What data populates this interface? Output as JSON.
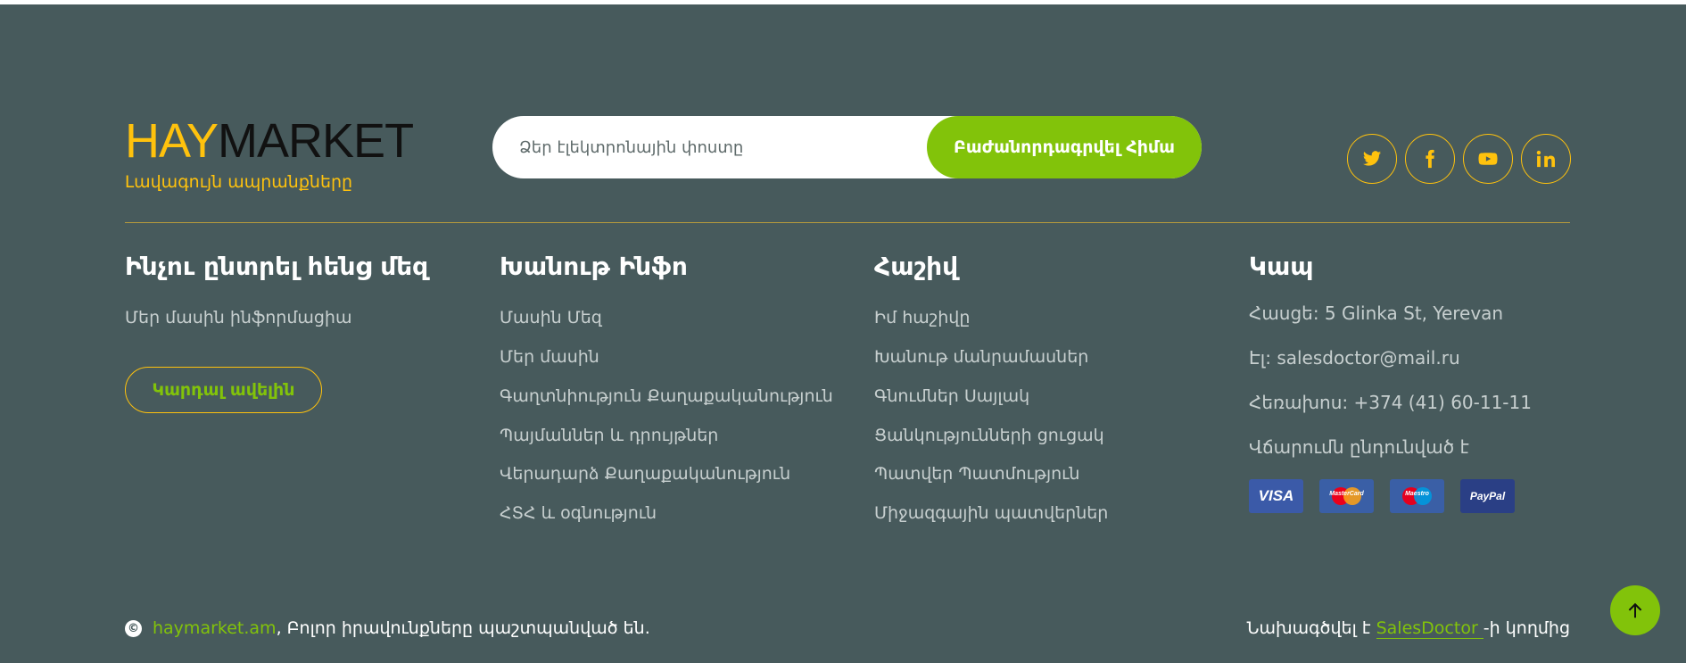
{
  "brand": {
    "logo_part1": "HAY",
    "logo_part2": "MARKET",
    "tagline": "Լավագույն ապրանքները"
  },
  "subscribe": {
    "placeholder": "Ձեր էլեկտրոնային փոստը",
    "button_label": "Բաժանորդագրվել Հիմա"
  },
  "socials": [
    {
      "icon": "twitter-icon"
    },
    {
      "icon": "facebook-icon"
    },
    {
      "icon": "youtube-icon"
    },
    {
      "icon": "linkedin-icon"
    }
  ],
  "columns": {
    "why": {
      "title": "Ինչու ընտրել հենց մեզ",
      "text": "Մեր մասին ինֆորմացիա",
      "button_label": "Կարդալ ավելին"
    },
    "shop_info": {
      "title": "Խանութ Ինֆո",
      "links": [
        "Մասին Մեզ",
        "Մեր մասին",
        "Գաղտնիություն Քաղաքականություն",
        "Պայմաններ և դրույթներ",
        "Վերադարձ Քաղաքականություն",
        "ՀՏՀ և օգնություն"
      ]
    },
    "account": {
      "title": "Հաշիվ",
      "links": [
        "Իմ հաշիվը",
        "Խանութ մանրամասներ",
        "Գնումներ Սայլակ",
        "Ցանկությունների ցուցակ",
        "Պատվեր Պատմություն",
        "Միջազգային պատվերներ"
      ]
    },
    "contact": {
      "title": "Կապ",
      "address": "Հասցե: 5 Glinka St, Yerevan",
      "email": "Էլ: salesdoctor@mail.ru",
      "phone": "Հեռախոս: +374 (41) 60-11-11",
      "payment_label": "Վճարումն ընդունված է",
      "payments": [
        "VISA",
        "MasterCard",
        "Maestro",
        "PayPal"
      ]
    }
  },
  "bottom": {
    "copyright_symbol": "©",
    "site": "haymarket.am",
    "rights": ", Բոլոր իրավունքները պաշտպանված են.",
    "credit_prefix": "Նախագծվել է ",
    "credit_link": "SalesDoctor ",
    "credit_suffix": "-ի կողմից"
  },
  "colors": {
    "background": "#475a5c",
    "accent_yellow": "#ffc20d",
    "accent_green": "#82c30a"
  }
}
